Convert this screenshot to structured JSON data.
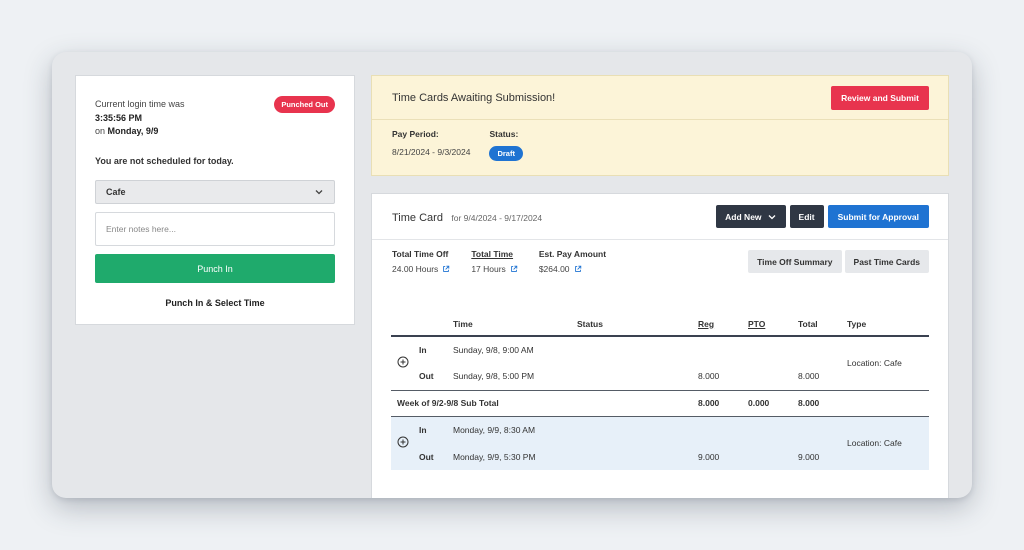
{
  "punch_card": {
    "login_prefix": "Current login time was",
    "login_time": "3:35:56 PM",
    "login_day_prefix": "on",
    "login_day": "Monday, 9/9",
    "status_badge": "Punched Out",
    "schedule_note": "You are not scheduled for today.",
    "location_select": "Cafe",
    "notes_placeholder": "Enter notes here...",
    "punch_in_label": "Punch In",
    "punch_select_label": "Punch In & Select Time"
  },
  "awaiting": {
    "title": "Time Cards Awaiting Submission!",
    "review_button": "Review and Submit",
    "pay_period_label": "Pay Period:",
    "pay_period_value": "8/21/2024 - 9/3/2024",
    "status_label": "Status:",
    "status_value": "Draft"
  },
  "timecard": {
    "title": "Time Card",
    "range": "for 9/4/2024 - 9/17/2024",
    "add_new": "Add New",
    "edit": "Edit",
    "submit": "Submit for Approval",
    "summary": [
      {
        "label": "Total Time Off",
        "value": "24.00 Hours"
      },
      {
        "label": "Total Time",
        "value": "17 Hours"
      },
      {
        "label": "Est. Pay Amount",
        "value": "$264.00"
      }
    ],
    "time_off_summary": "Time Off Summary",
    "past_time_cards": "Past Time Cards",
    "columns": {
      "time": "Time",
      "status": "Status",
      "reg": "Reg",
      "pto": "PTO",
      "total": "Total",
      "type": "Type"
    },
    "entries": [
      {
        "in_label": "In",
        "in_time": "Sunday, 9/8, 9:00 AM",
        "out_label": "Out",
        "out_time": "Sunday, 9/8, 5:00 PM",
        "reg": "8.000",
        "total": "8.000",
        "type": "Location: Cafe"
      },
      {
        "in_label": "In",
        "in_time": "Monday, 9/9, 8:30 AM",
        "out_label": "Out",
        "out_time": "Monday, 9/9, 5:30 PM",
        "reg": "9.000",
        "total": "9.000",
        "type": "Location: Cafe"
      }
    ],
    "subtotal": {
      "label": "Week of 9/2-9/8 Sub Total",
      "reg": "8.000",
      "pto": "0.000",
      "total": "8.000"
    }
  },
  "colors": {
    "accent_red": "#e8344e",
    "accent_green": "#1faa6c",
    "accent_blue": "#1f73d2",
    "dark_button": "#2f3744",
    "banner_bg": "#fcf4d8"
  },
  "icons": [
    "chevron-down-icon",
    "external-link-icon",
    "plus-circle-icon"
  ]
}
